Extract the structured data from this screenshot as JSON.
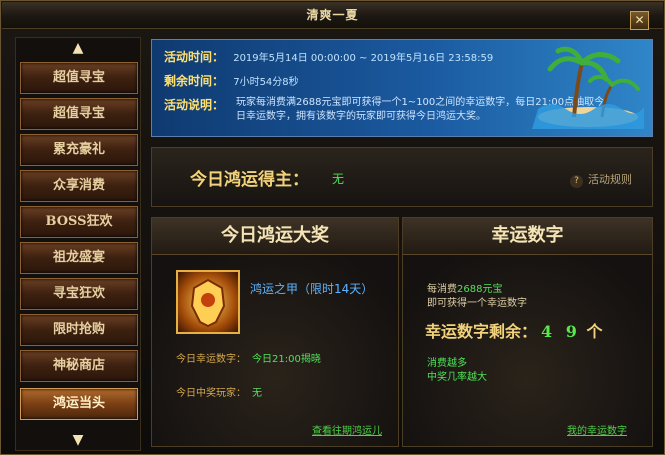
{
  "window": {
    "title": "清爽一夏"
  },
  "sidebar": {
    "items": [
      {
        "label": "超值寻宝"
      },
      {
        "label": "超值寻宝"
      },
      {
        "label": "累充豪礼"
      },
      {
        "label": "众享消费"
      },
      {
        "label": "BOSS狂欢"
      },
      {
        "label": "祖龙盛宴"
      },
      {
        "label": "寻宝狂欢"
      },
      {
        "label": "限时抢购"
      },
      {
        "label": "神秘商店"
      },
      {
        "label": "鸿运当头"
      }
    ]
  },
  "banner": {
    "time_label": "活动时间：",
    "time_value": "2019年5月14日 00:00:00 ~ 2019年5月16日 23:58:59",
    "remain_label": "剩余时间：",
    "remain_value": "7小时54分8秒",
    "desc_label": "活动说明：",
    "desc_value": "玩家每消费满2688元宝即可获得一个1~100之间的幸运数字，每日21:00点抽取今日幸运数字，拥有该数字的玩家即可获得今日鸿运大奖。"
  },
  "winner": {
    "label": "今日鸿运得主：",
    "value": "无",
    "rules_link": "活动规则"
  },
  "prize_panel": {
    "title": "今日鸿运大奖",
    "item_name": "鸿运之甲（限时14天）",
    "today_number_label": "今日幸运数字：",
    "today_number_value": "今日21:00揭晓",
    "today_winner_label": "今日中奖玩家：",
    "today_winner_value": "无",
    "history_link": "查看往期鸿运儿"
  },
  "lucky_panel": {
    "title": "幸运数字",
    "line1_prefix": "每消费",
    "line1_amount": "2688元宝",
    "line2": "即可获得一个幸运数字",
    "remaining_label": "幸运数字剩余：",
    "remaining_value": "4 9",
    "remaining_unit": "个",
    "note1": "消费越多",
    "note2": "中奖几率越大",
    "my_numbers_link": "我的幸运数字"
  },
  "icons": {
    "scroll_up": "chevron-up-icon",
    "scroll_down": "chevron-down-icon",
    "close": "close-icon",
    "help": "question-icon"
  }
}
